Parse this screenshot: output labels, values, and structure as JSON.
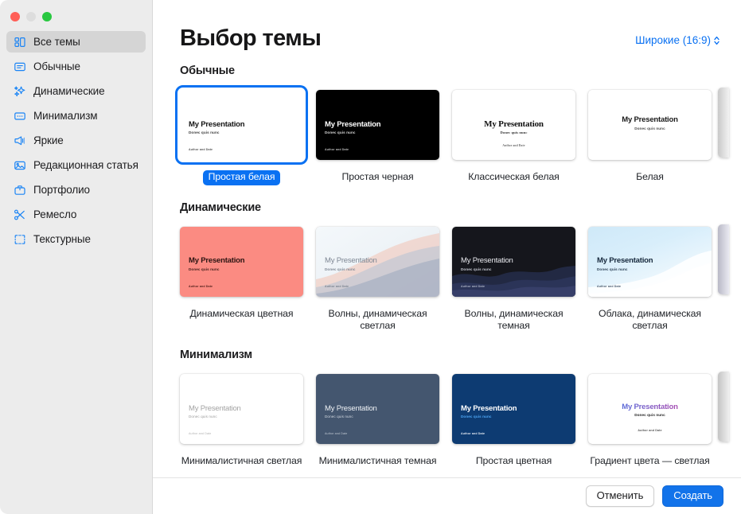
{
  "window": {
    "traffic_lights": [
      "close",
      "minimize",
      "zoom"
    ]
  },
  "sidebar": {
    "items": [
      {
        "label": "Все темы",
        "icon": "grid-icon",
        "selected": true
      },
      {
        "label": "Обычные",
        "icon": "slide-lines-icon",
        "selected": false
      },
      {
        "label": "Динамические",
        "icon": "sparkles-icon",
        "selected": false
      },
      {
        "label": "Минимализм",
        "icon": "slide-dots-icon",
        "selected": false
      },
      {
        "label": "Яркие",
        "icon": "megaphone-icon",
        "selected": false
      },
      {
        "label": "Редакционная статья",
        "icon": "photo-icon",
        "selected": false
      },
      {
        "label": "Портфолио",
        "icon": "briefcase-icon",
        "selected": false
      },
      {
        "label": "Ремесло",
        "icon": "scissors-icon",
        "selected": false
      },
      {
        "label": "Текстурные",
        "icon": "frame-icon",
        "selected": false
      }
    ]
  },
  "header": {
    "title": "Выбор темы",
    "aspect_ratio": "Широкие (16:9)"
  },
  "slide_text": {
    "title": "My Presentation",
    "subtitle": "Donec quis nunc",
    "footer": "Author and Date"
  },
  "sections": [
    {
      "title": "Обычные",
      "themes": [
        {
          "caption": "Простая белая",
          "selected": true
        },
        {
          "caption": "Простая черная",
          "selected": false
        },
        {
          "caption": "Классическая белая",
          "selected": false
        },
        {
          "caption": "Белая",
          "selected": false
        }
      ]
    },
    {
      "title": "Динамические",
      "themes": [
        {
          "caption": "Динамическая цветная",
          "selected": false
        },
        {
          "caption": "Волны, динамическая светлая",
          "selected": false
        },
        {
          "caption": "Волны, динамическая темная",
          "selected": false
        },
        {
          "caption": "Облака, динамическая светлая",
          "selected": false
        }
      ]
    },
    {
      "title": "Минимализм",
      "themes": [
        {
          "caption": "Минималистичная светлая",
          "selected": false
        },
        {
          "caption": "Минималистичная темная",
          "selected": false
        },
        {
          "caption": "Простая цветная",
          "selected": false
        },
        {
          "caption": "Градиент цвета — светлая",
          "selected": false
        }
      ]
    }
  ],
  "footer": {
    "cancel_label": "Отменить",
    "create_label": "Создать"
  },
  "colors": {
    "accent": "#0a71f2",
    "primary_button": "#1273ea",
    "sidebar_bg": "#ececec",
    "selected_row": "#d5d5d5",
    "theme_coral": "#fb8b82",
    "theme_navy": "#0d3b72",
    "theme_slate": "#44566f",
    "theme_dark": "#15161c"
  }
}
